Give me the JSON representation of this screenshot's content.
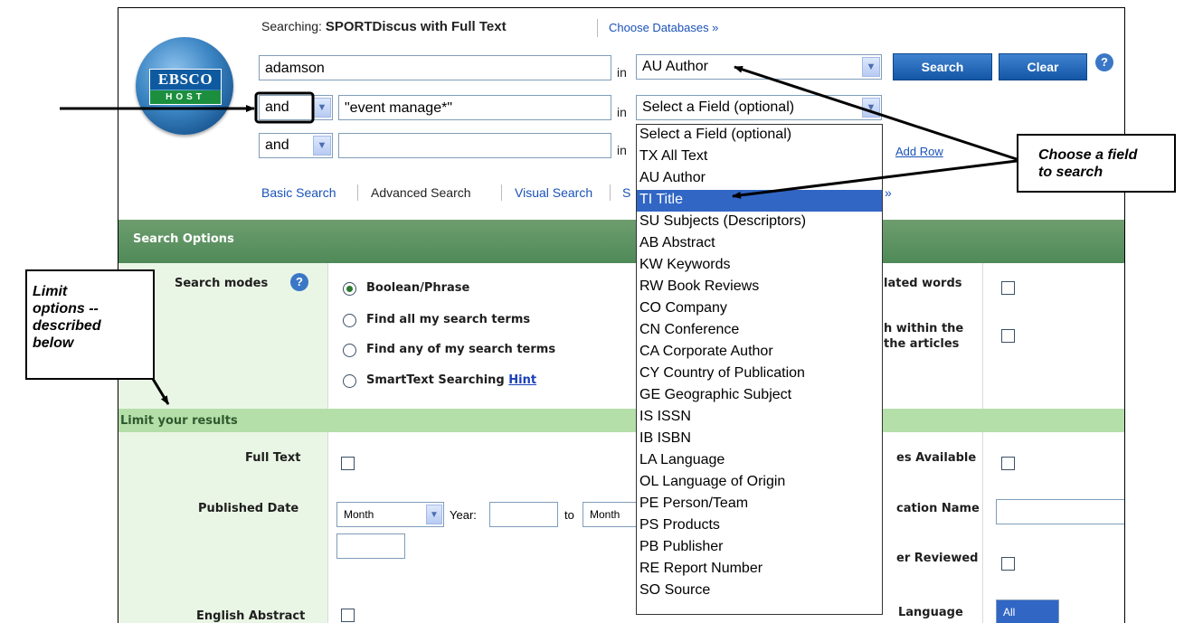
{
  "header": {
    "searching_label": "Searching:",
    "database_name": "SPORTDiscus with Full Text",
    "choose_databases": "Choose Databases »",
    "logo_top": "EBSCO",
    "logo_bottom": "HOST"
  },
  "search_rows": [
    {
      "operator": "",
      "term": "adamson",
      "in_label": "in",
      "field": "AU Author"
    },
    {
      "operator": "and",
      "term": "\"event manage*\"",
      "in_label": "in",
      "field": "Select a Field (optional)"
    },
    {
      "operator": "and",
      "term": "",
      "in_label": "in",
      "field": ""
    }
  ],
  "buttons": {
    "search": "Search",
    "clear": "Clear",
    "help": "?"
  },
  "add_row": "Add Row",
  "nav": {
    "basic_search": "Basic Search",
    "advanced_search": "Advanced Search",
    "visual_search": "Visual Search",
    "partial_link": "S",
    "partial_trailing": "»"
  },
  "search_options": {
    "header": "Search Options",
    "search_modes_label": "Search modes",
    "modes": [
      {
        "label": "Boolean/Phrase",
        "selected": true
      },
      {
        "label": "Find all my search terms",
        "selected": false
      },
      {
        "label": "Find any of my search terms",
        "selected": false
      },
      {
        "label": "SmartText Searching",
        "selected": false,
        "hint": "Hint"
      }
    ],
    "right_labels": [
      "lated words",
      "h within the",
      "the articles"
    ]
  },
  "limits": {
    "header": "Limit your results",
    "full_text": "Full Text",
    "published_date": "Published Date",
    "month": "Month",
    "year_label": "Year:",
    "to_label": "to",
    "month2": "Month",
    "english_abstract": "English Abstract",
    "right_labels": [
      "es Available",
      "cation Name",
      "er Reviewed",
      "Language"
    ],
    "language_value": "All"
  },
  "dropdown_options": [
    "Select a Field (optional)",
    "TX All Text",
    "AU Author",
    "TI Title",
    "SU Subjects (Descriptors)",
    "AB Abstract",
    "KW Keywords",
    "RW Book Reviews",
    "CO Company",
    "CN Conference",
    "CA Corporate Author",
    "CY Country of Publication",
    "GE Geographic Subject",
    "IS ISSN",
    "IB ISBN",
    "LA Language",
    "OL Language of Origin",
    "PE Person/Team",
    "PS Products",
    "PB Publisher",
    "RE Report Number",
    "SO Source"
  ],
  "dropdown_selected_index": 3,
  "callouts": {
    "choose_field": [
      "Choose a field",
      "to search"
    ],
    "limit_options": [
      "Limit",
      "options --",
      "described",
      "below"
    ]
  },
  "colors": {
    "band_dark": "#5b925f",
    "band_light": "#b5dfa9",
    "link": "#1a52b8",
    "button": "#1456a6",
    "selected_option": "#3166c5"
  }
}
